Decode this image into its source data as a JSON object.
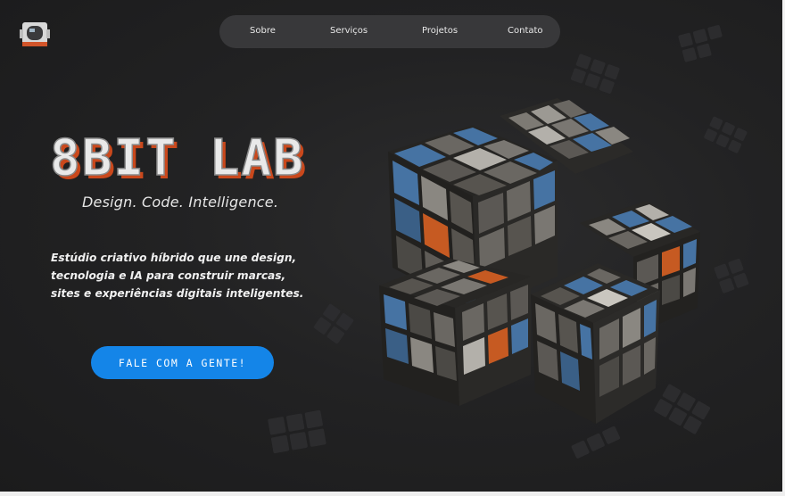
{
  "brand": {
    "logo_icon": "astronaut-helmet-icon",
    "title": "8BIT LAB"
  },
  "nav": {
    "items": [
      {
        "label": "Sobre"
      },
      {
        "label": "Serviços"
      },
      {
        "label": "Projetos"
      },
      {
        "label": "Contato"
      }
    ]
  },
  "hero": {
    "tagline": "Design. Code. Intelligence.",
    "description": "Estúdio criativo híbrido que une design, tecnologia e IA para construir marcas, sites e experiências digitais inteligentes.",
    "cta_label": "FALE COM A GENTE!"
  },
  "colors": {
    "background": "#1e1e1f",
    "accent_blue": "#1485e8",
    "accent_orange": "#d9531e",
    "cube_blue": "#3f6e9e",
    "cube_gray": "#57544f"
  }
}
